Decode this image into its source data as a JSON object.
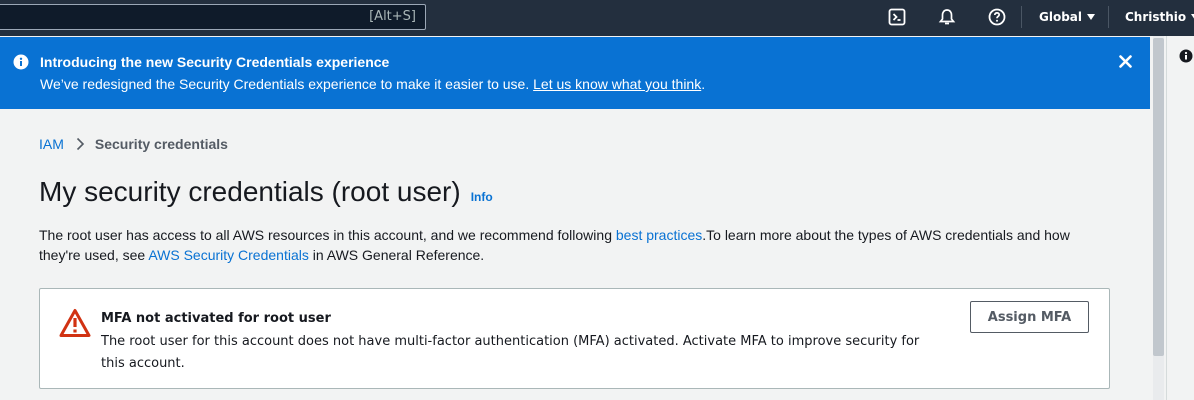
{
  "topbar": {
    "search_shortcut": "[Alt+S]",
    "icons": [
      "cloudshell-icon",
      "notifications-icon",
      "help-icon"
    ],
    "region_label": "Global",
    "account_label": "Christhio"
  },
  "flash": {
    "title": "Introducing the new Security Credentials experience",
    "text": "We’ve redesigned the Security Credentials experience to make it easier to use. ",
    "link": "Let us know what you think",
    "after_link": ".",
    "background": "#0972d3"
  },
  "breadcrumb": {
    "root": "IAM",
    "current": "Security credentials"
  },
  "page": {
    "title": "My security credentials (root user)",
    "info_link": "Info",
    "desc_part1": "The root user has access to all AWS resources in this account, and we recommend following ",
    "desc_link1": "best practices",
    "desc_part2": ".To learn more about the types of AWS credentials and how they're used, see ",
    "desc_link2": "AWS Security Credentials",
    "desc_part3": " in AWS General Reference."
  },
  "alert": {
    "title": "MFA not activated for root user",
    "text": "The root user for this account does not have multi-factor authentication (MFA) activated. Activate MFA to improve security for this account.",
    "button": "Assign MFA",
    "icon_color": "#d13212"
  }
}
